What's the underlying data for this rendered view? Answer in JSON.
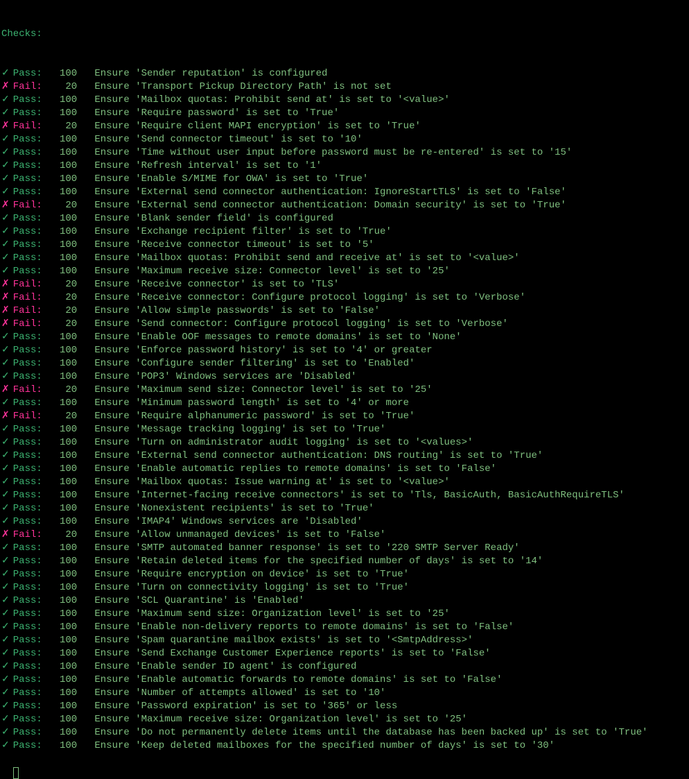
{
  "header": "Checks:",
  "pass_symbol": "✓",
  "fail_symbol": "✗",
  "pass_label": "Pass:",
  "fail_label": "Fail:",
  "pass_score": "100",
  "fail_score": "20",
  "rows": [
    {
      "status": "pass",
      "desc": "Ensure 'Sender reputation' is configured"
    },
    {
      "status": "fail",
      "desc": "Ensure 'Transport Pickup Directory Path' is not set"
    },
    {
      "status": "pass",
      "desc": "Ensure 'Mailbox quotas: Prohibit send at' is set to '<value>'"
    },
    {
      "status": "pass",
      "desc": "Ensure 'Require password' is set to 'True'"
    },
    {
      "status": "fail",
      "desc": "Ensure 'Require client MAPI encryption' is set to 'True'"
    },
    {
      "status": "pass",
      "desc": "Ensure 'Send connector timeout' is set to '10'"
    },
    {
      "status": "pass",
      "desc": "Ensure 'Time without user input before password must be re-entered' is set to '15'"
    },
    {
      "status": "pass",
      "desc": "Ensure 'Refresh interval' is set to '1'"
    },
    {
      "status": "pass",
      "desc": "Ensure 'Enable S/MIME for OWA' is set to 'True'"
    },
    {
      "status": "pass",
      "desc": "Ensure 'External send connector authentication: IgnoreStartTLS' is set to 'False'"
    },
    {
      "status": "fail",
      "desc": "Ensure 'External send connector authentication: Domain security' is set to 'True'"
    },
    {
      "status": "pass",
      "desc": "Ensure 'Blank sender field' is configured"
    },
    {
      "status": "pass",
      "desc": "Ensure 'Exchange recipient filter' is set to 'True'"
    },
    {
      "status": "pass",
      "desc": "Ensure 'Receive connector timeout' is set to '5'"
    },
    {
      "status": "pass",
      "desc": "Ensure 'Mailbox quotas: Prohibit send and receive at' is set to '<value>'"
    },
    {
      "status": "pass",
      "desc": "Ensure 'Maximum receive size: Connector level' is set to '25'"
    },
    {
      "status": "fail",
      "desc": "Ensure 'Receive connector' is set to 'TLS'"
    },
    {
      "status": "fail",
      "desc": "Ensure 'Receive connector: Configure protocol logging' is set to 'Verbose'"
    },
    {
      "status": "fail",
      "desc": "Ensure 'Allow simple passwords' is set to 'False'"
    },
    {
      "status": "fail",
      "desc": "Ensure 'Send connector: Configure protocol logging' is set to 'Verbose'"
    },
    {
      "status": "pass",
      "desc": "Ensure 'Enable OOF messages to remote domains' is set to 'None'"
    },
    {
      "status": "pass",
      "desc": "Ensure 'Enforce password history' is set to '4' or greater"
    },
    {
      "status": "pass",
      "desc": "Ensure 'Configure sender filtering' is set to 'Enabled'"
    },
    {
      "status": "pass",
      "desc": "Ensure 'POP3' Windows services are 'Disabled'"
    },
    {
      "status": "fail",
      "desc": "Ensure 'Maximum send size: Connector level' is set to '25'"
    },
    {
      "status": "pass",
      "desc": "Ensure 'Minimum password length' is set to '4' or more"
    },
    {
      "status": "fail",
      "desc": "Ensure 'Require alphanumeric password' is set to 'True'"
    },
    {
      "status": "pass",
      "desc": "Ensure 'Message tracking logging' is set to 'True'"
    },
    {
      "status": "pass",
      "desc": "Ensure 'Turn on administrator audit logging' is set to '<values>'"
    },
    {
      "status": "pass",
      "desc": "Ensure 'External send connector authentication: DNS routing' is set to 'True'"
    },
    {
      "status": "pass",
      "desc": "Ensure 'Enable automatic replies to remote domains' is set to 'False'"
    },
    {
      "status": "pass",
      "desc": "Ensure 'Mailbox quotas: Issue warning at' is set to '<value>'"
    },
    {
      "status": "pass",
      "desc": "Ensure 'Internet-facing receive connectors' is set to 'Tls, BasicAuth, BasicAuthRequireTLS'"
    },
    {
      "status": "pass",
      "desc": "Ensure 'Nonexistent recipients' is set to 'True'"
    },
    {
      "status": "pass",
      "desc": "Ensure 'IMAP4' Windows services are 'Disabled'"
    },
    {
      "status": "fail",
      "desc": "Ensure 'Allow unmanaged devices' is set to 'False'"
    },
    {
      "status": "pass",
      "desc": "Ensure 'SMTP automated banner response' is set to '220 SMTP Server Ready'"
    },
    {
      "status": "pass",
      "desc": "Ensure 'Retain deleted items for the specified number of days' is set to '14'"
    },
    {
      "status": "pass",
      "desc": "Ensure 'Require encryption on device' is set to 'True'"
    },
    {
      "status": "pass",
      "desc": "Ensure 'Turn on connectivity logging' is set to 'True'"
    },
    {
      "status": "pass",
      "desc": "Ensure 'SCL Quarantine' is 'Enabled'"
    },
    {
      "status": "pass",
      "desc": "Ensure 'Maximum send size: Organization level' is set to '25'"
    },
    {
      "status": "pass",
      "desc": "Ensure 'Enable non-delivery reports to remote domains' is set to 'False'"
    },
    {
      "status": "pass",
      "desc": "Ensure 'Spam quarantine mailbox exists' is set to '<SmtpAddress>'"
    },
    {
      "status": "pass",
      "desc": "Ensure 'Send Exchange Customer Experience reports' is set to 'False'"
    },
    {
      "status": "pass",
      "desc": "Ensure 'Enable sender ID agent' is configured"
    },
    {
      "status": "pass",
      "desc": "Ensure 'Enable automatic forwards to remote domains' is set to 'False'"
    },
    {
      "status": "pass",
      "desc": "Ensure 'Number of attempts allowed' is set to '10'"
    },
    {
      "status": "pass",
      "desc": "Ensure 'Password expiration' is set to '365' or less"
    },
    {
      "status": "pass",
      "desc": "Ensure 'Maximum receive size: Organization level' is set to '25'"
    },
    {
      "status": "pass",
      "desc": "Ensure 'Do not permanently delete items until the database has been backed up' is set to 'True'"
    },
    {
      "status": "pass",
      "desc": "Ensure 'Keep deleted mailboxes for the specified number of days' is set to '30'"
    }
  ]
}
